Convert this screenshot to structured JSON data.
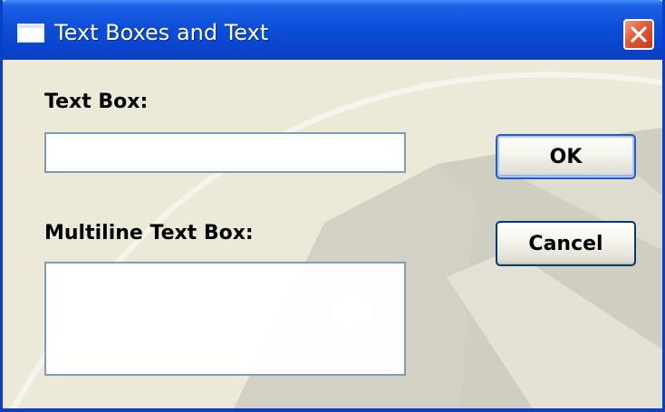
{
  "window": {
    "title": "Text Boxes and Text",
    "close_symbol": "×"
  },
  "form": {
    "text_box_label": "Text Box:",
    "text_box_value": "",
    "multiline_label": "Multiline Text Box:",
    "multiline_value": ""
  },
  "buttons": {
    "ok_label": "OK",
    "cancel_label": "Cancel"
  },
  "colors": {
    "titlebar": "#0a46cf",
    "dialog_face": "#ece9d8",
    "close_button": "#e35a36",
    "textbox_border": "#7f9db9"
  },
  "icons": {
    "window_icon": "window-icon",
    "close_icon": "close-icon"
  }
}
